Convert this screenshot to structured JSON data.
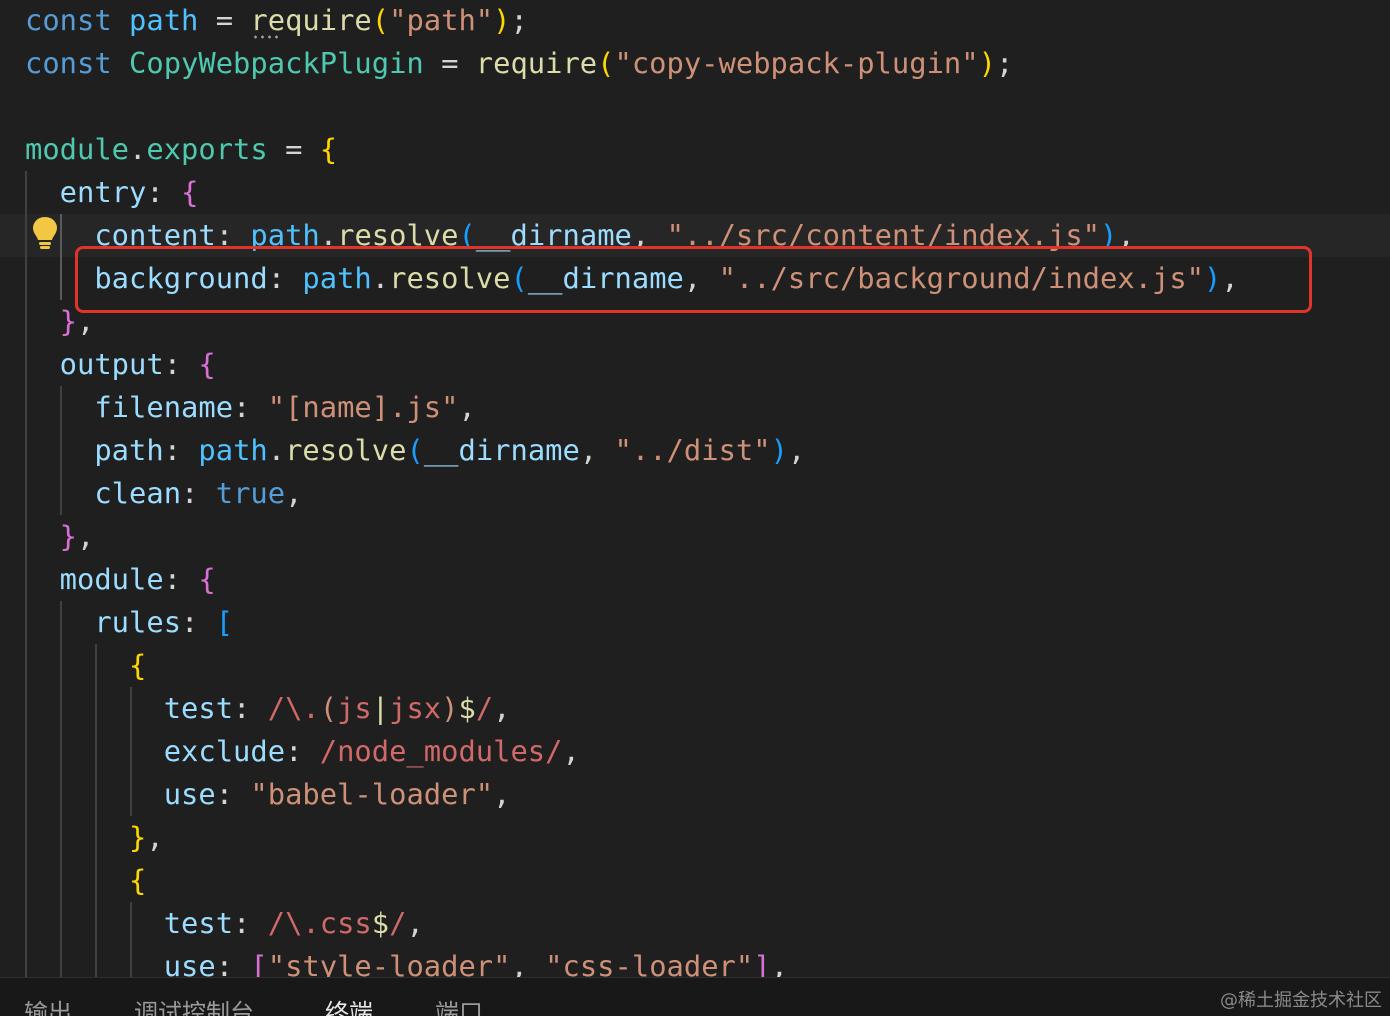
{
  "editor": {
    "language": "javascript",
    "lines": [
      [
        {
          "t": "const ",
          "c": "#569cd6"
        },
        {
          "t": "path",
          "c": "#4fc1ff"
        },
        {
          "t": " = ",
          "c": "#d4d4d4"
        },
        {
          "t": "require",
          "c": "#dcdcaa"
        },
        {
          "t": "(",
          "c": "#ffd700"
        },
        {
          "t": "\"path\"",
          "c": "#ce9178"
        },
        {
          "t": ")",
          "c": "#ffd700"
        },
        {
          "t": ";",
          "c": "#d4d4d4"
        }
      ],
      [
        {
          "t": "const ",
          "c": "#569cd6"
        },
        {
          "t": "CopyWebpackPlugin",
          "c": "#4ec9b0"
        },
        {
          "t": " = ",
          "c": "#d4d4d4"
        },
        {
          "t": "require",
          "c": "#dcdcaa"
        },
        {
          "t": "(",
          "c": "#ffd700"
        },
        {
          "t": "\"copy-webpack-plugin\"",
          "c": "#ce9178"
        },
        {
          "t": ")",
          "c": "#ffd700"
        },
        {
          "t": ";",
          "c": "#d4d4d4"
        }
      ],
      [],
      [
        {
          "t": "module",
          "c": "#4ec9b0"
        },
        {
          "t": ".",
          "c": "#d4d4d4"
        },
        {
          "t": "exports",
          "c": "#4ec9b0"
        },
        {
          "t": " = ",
          "c": "#d4d4d4"
        },
        {
          "t": "{",
          "c": "#ffd700"
        }
      ],
      [
        {
          "t": "  entry",
          "c": "#9cdcfe"
        },
        {
          "t": ": ",
          "c": "#d4d4d4"
        },
        {
          "t": "{",
          "c": "#da70d6"
        }
      ],
      [
        {
          "t": "    content",
          "c": "#9cdcfe"
        },
        {
          "t": ": ",
          "c": "#d4d4d4"
        },
        {
          "t": "path",
          "c": "#4fc1ff"
        },
        {
          "t": ".",
          "c": "#d4d4d4"
        },
        {
          "t": "resolve",
          "c": "#dcdcaa"
        },
        {
          "t": "(",
          "c": "#179fff"
        },
        {
          "t": "__dirname",
          "c": "#9cdcfe"
        },
        {
          "t": ", ",
          "c": "#d4d4d4"
        },
        {
          "t": "\"../src/content/index.js\"",
          "c": "#ce9178"
        },
        {
          "t": ")",
          "c": "#179fff"
        },
        {
          "t": ",",
          "c": "#d4d4d4"
        }
      ],
      [
        {
          "t": "    background",
          "c": "#9cdcfe"
        },
        {
          "t": ": ",
          "c": "#d4d4d4"
        },
        {
          "t": "path",
          "c": "#4fc1ff"
        },
        {
          "t": ".",
          "c": "#d4d4d4"
        },
        {
          "t": "resolve",
          "c": "#dcdcaa"
        },
        {
          "t": "(",
          "c": "#179fff"
        },
        {
          "t": "__dirname",
          "c": "#9cdcfe"
        },
        {
          "t": ", ",
          "c": "#d4d4d4"
        },
        {
          "t": "\"../src/background/index.js\"",
          "c": "#ce9178"
        },
        {
          "t": ")",
          "c": "#179fff"
        },
        {
          "t": ",",
          "c": "#d4d4d4"
        }
      ],
      [
        {
          "t": "  }",
          "c": "#da70d6"
        },
        {
          "t": ",",
          "c": "#d4d4d4"
        }
      ],
      [
        {
          "t": "  output",
          "c": "#9cdcfe"
        },
        {
          "t": ": ",
          "c": "#d4d4d4"
        },
        {
          "t": "{",
          "c": "#da70d6"
        }
      ],
      [
        {
          "t": "    filename",
          "c": "#9cdcfe"
        },
        {
          "t": ": ",
          "c": "#d4d4d4"
        },
        {
          "t": "\"[name].js\"",
          "c": "#ce9178"
        },
        {
          "t": ",",
          "c": "#d4d4d4"
        }
      ],
      [
        {
          "t": "    path",
          "c": "#9cdcfe"
        },
        {
          "t": ": ",
          "c": "#d4d4d4"
        },
        {
          "t": "path",
          "c": "#4fc1ff"
        },
        {
          "t": ".",
          "c": "#d4d4d4"
        },
        {
          "t": "resolve",
          "c": "#dcdcaa"
        },
        {
          "t": "(",
          "c": "#179fff"
        },
        {
          "t": "__dirname",
          "c": "#9cdcfe"
        },
        {
          "t": ", ",
          "c": "#d4d4d4"
        },
        {
          "t": "\"../dist\"",
          "c": "#ce9178"
        },
        {
          "t": ")",
          "c": "#179fff"
        },
        {
          "t": ",",
          "c": "#d4d4d4"
        }
      ],
      [
        {
          "t": "    clean",
          "c": "#9cdcfe"
        },
        {
          "t": ": ",
          "c": "#d4d4d4"
        },
        {
          "t": "true",
          "c": "#569cd6"
        },
        {
          "t": ",",
          "c": "#d4d4d4"
        }
      ],
      [
        {
          "t": "  }",
          "c": "#da70d6"
        },
        {
          "t": ",",
          "c": "#d4d4d4"
        }
      ],
      [
        {
          "t": "  module",
          "c": "#9cdcfe"
        },
        {
          "t": ": ",
          "c": "#d4d4d4"
        },
        {
          "t": "{",
          "c": "#da70d6"
        }
      ],
      [
        {
          "t": "    rules",
          "c": "#9cdcfe"
        },
        {
          "t": ": ",
          "c": "#d4d4d4"
        },
        {
          "t": "[",
          "c": "#179fff"
        }
      ],
      [
        {
          "t": "      {",
          "c": "#ffd700"
        }
      ],
      [
        {
          "t": "        test",
          "c": "#9cdcfe"
        },
        {
          "t": ": ",
          "c": "#d4d4d4"
        },
        {
          "t": "/\\.",
          "c": "#d16969"
        },
        {
          "t": "(",
          "c": "#ce9178"
        },
        {
          "t": "js",
          "c": "#d16969"
        },
        {
          "t": "|",
          "c": "#dcdcaa"
        },
        {
          "t": "jsx",
          "c": "#d16969"
        },
        {
          "t": ")",
          "c": "#ce9178"
        },
        {
          "t": "$",
          "c": "#dcdcaa"
        },
        {
          "t": "/",
          "c": "#d16969"
        },
        {
          "t": ",",
          "c": "#d4d4d4"
        }
      ],
      [
        {
          "t": "        exclude",
          "c": "#9cdcfe"
        },
        {
          "t": ": ",
          "c": "#d4d4d4"
        },
        {
          "t": "/node_modules/",
          "c": "#d16969"
        },
        {
          "t": ",",
          "c": "#d4d4d4"
        }
      ],
      [
        {
          "t": "        use",
          "c": "#9cdcfe"
        },
        {
          "t": ": ",
          "c": "#d4d4d4"
        },
        {
          "t": "\"babel-loader\"",
          "c": "#ce9178"
        },
        {
          "t": ",",
          "c": "#d4d4d4"
        }
      ],
      [
        {
          "t": "      }",
          "c": "#ffd700"
        },
        {
          "t": ",",
          "c": "#d4d4d4"
        }
      ],
      [
        {
          "t": "      {",
          "c": "#ffd700"
        }
      ],
      [
        {
          "t": "        test",
          "c": "#9cdcfe"
        },
        {
          "t": ": ",
          "c": "#d4d4d4"
        },
        {
          "t": "/\\.css",
          "c": "#d16969"
        },
        {
          "t": "$",
          "c": "#dcdcaa"
        },
        {
          "t": "/",
          "c": "#d16969"
        },
        {
          "t": ",",
          "c": "#d4d4d4"
        }
      ],
      [
        {
          "t": "        use",
          "c": "#9cdcfe"
        },
        {
          "t": ": ",
          "c": "#d4d4d4"
        },
        {
          "t": "[",
          "c": "#da70d6"
        },
        {
          "t": "\"style-loader\"",
          "c": "#ce9178"
        },
        {
          "t": ", ",
          "c": "#d4d4d4"
        },
        {
          "t": "\"css-loader\"",
          "c": "#ce9178"
        },
        {
          "t": "]",
          "c": "#da70d6"
        },
        {
          "t": ",",
          "c": "#d4d4d4"
        }
      ]
    ],
    "highlight_color": "#e0342b",
    "lightbulb_icon": "lightbulb-icon"
  },
  "panel": {
    "tabs": [
      {
        "label": "输出"
      },
      {
        "label": "调试控制台"
      },
      {
        "label": "终端"
      },
      {
        "label": "端口"
      }
    ],
    "active_tab": "终端"
  },
  "watermark": "@稀土掘金技术社区"
}
